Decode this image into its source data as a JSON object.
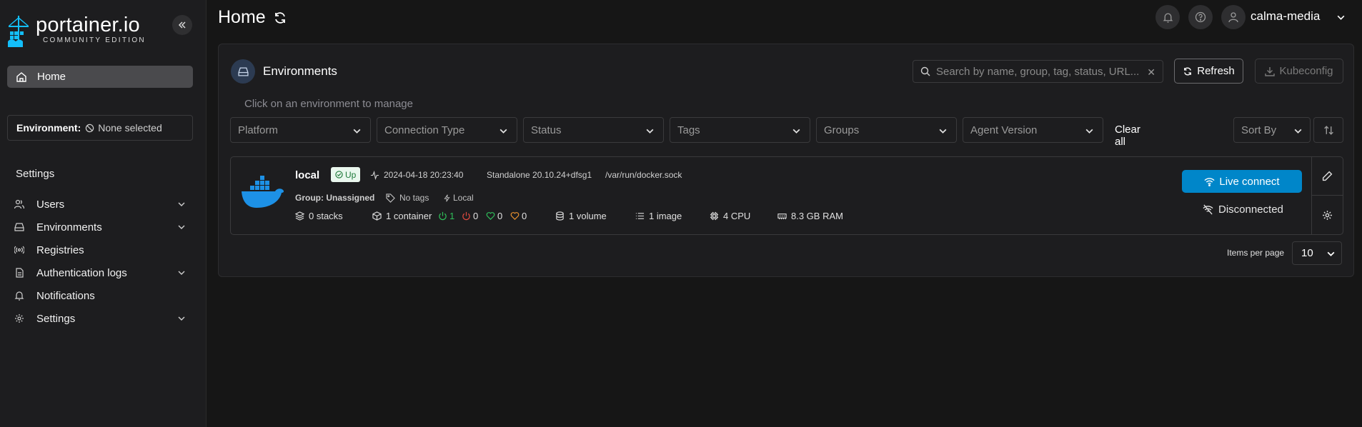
{
  "brand": {
    "name": "portainer.io",
    "edition": "COMMUNITY EDITION",
    "colors": {
      "accent": "#0086c9",
      "logo": "#13bef9"
    }
  },
  "sidebar": {
    "home_label": "Home",
    "environment_label": "Environment:",
    "environment_value": "None selected",
    "settings_title": "Settings",
    "items": [
      {
        "label": "Users",
        "icon": "users-icon",
        "expandable": true
      },
      {
        "label": "Environments",
        "icon": "drive-icon",
        "expandable": true
      },
      {
        "label": "Registries",
        "icon": "radio-icon",
        "expandable": false
      },
      {
        "label": "Authentication logs",
        "icon": "file-icon",
        "expandable": true
      },
      {
        "label": "Notifications",
        "icon": "bell-icon",
        "expandable": false
      },
      {
        "label": "Settings",
        "icon": "gear-icon",
        "expandable": true
      }
    ]
  },
  "header": {
    "title": "Home",
    "user": "calma-media"
  },
  "panel": {
    "title": "Environments",
    "search_placeholder": "Search by name, group, tag, status, URL...",
    "refresh_label": "Refresh",
    "kubeconfig_label": "Kubeconfig",
    "hint": "Click on an environment to manage",
    "filters": [
      "Platform",
      "Connection Type",
      "Status",
      "Tags",
      "Groups",
      "Agent Version"
    ],
    "clear_all": "Clear all",
    "sort_by": "Sort By"
  },
  "environment": {
    "name": "local",
    "status": "Up",
    "heartbeat": "2024-04-18 20:23:40",
    "engine": "Standalone 20.10.24+dfsg1",
    "socket": "/var/run/docker.sock",
    "group": "Group: Unassigned",
    "tags": "No tags",
    "type": "Local",
    "stacks": "0 stacks",
    "containers": "1 container",
    "running": "1",
    "stopped": "0",
    "healthy": "0",
    "unhealthy": "0",
    "volumes": "1 volume",
    "images": "1 image",
    "cpu": "4 CPU",
    "ram": "8.3 GB RAM",
    "live_connect": "Live connect",
    "disconnected": "Disconnected"
  },
  "pagination": {
    "label": "Items per page",
    "value": "10"
  }
}
